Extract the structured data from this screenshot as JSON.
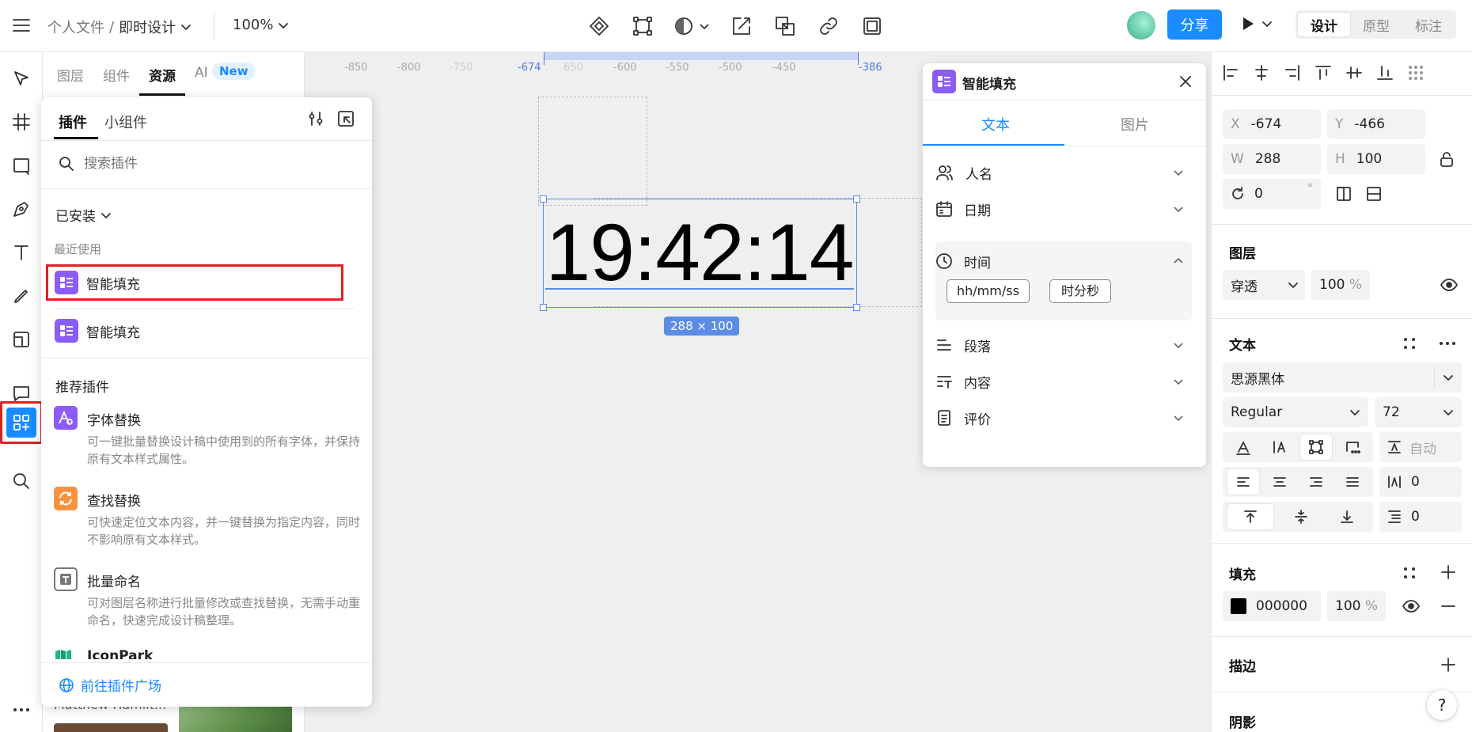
{
  "topbar": {
    "breadcrumb_parent": "个人文件",
    "breadcrumb_sep": "/",
    "file_name": "即时设计",
    "zoom": "100%",
    "share_label": "分享",
    "modes": [
      "设计",
      "原型",
      "标注"
    ]
  },
  "layers_panel": {
    "tabs": [
      "图层",
      "组件",
      "资源",
      "AI"
    ],
    "ai_badge": "New",
    "bottom_caption": "Matthew Hamilt..."
  },
  "plugin_popover": {
    "tabs": [
      "插件",
      "小组件"
    ],
    "search_placeholder": "搜索插件",
    "installed_label": "已安装",
    "recent_label": "最近使用",
    "recent_items": [
      "智能填充",
      "智能填充"
    ],
    "recommend_label": "推荐插件",
    "recommended": [
      {
        "title": "字体替换",
        "desc": "可一键批量替换设计稿中使用到的所有字体，并保持原有文本样式属性。"
      },
      {
        "title": "查找替换",
        "desc": "可快速定位文本内容，并一键替换为指定内容，同时不影响原有文本样式。"
      },
      {
        "title": "批量命名",
        "desc": "可对图层名称进行批量修改或查找替换，无需手动重命名，快速完成设计稿整理。"
      },
      {
        "title": "IconPark",
        "desc": ""
      }
    ],
    "footer_link": "前往插件广场"
  },
  "canvas": {
    "ruler_ticks": [
      "-850",
      "-800",
      "-750",
      "-674",
      "650",
      "-600",
      "-550",
      "-500",
      "-450",
      "-386"
    ],
    "text_content": "19:42:14",
    "size_badge": "288 × 100"
  },
  "smart_fill": {
    "title": "智能填充",
    "tabs": [
      "文本",
      "图片"
    ],
    "rows": [
      "人名",
      "日期",
      "时间",
      "段落",
      "内容",
      "评价"
    ],
    "time_options": [
      "hh/mm/ss",
      "时分秒"
    ]
  },
  "props": {
    "x_label": "X",
    "x": "-674",
    "y_label": "Y",
    "y": "-466",
    "w_label": "W",
    "w": "288",
    "h_label": "H",
    "h": "100",
    "rotation": "0",
    "rotation_unit": "°",
    "layer_section": "图层",
    "blend_mode": "穿透",
    "layer_opacity": "100",
    "pct": "%",
    "text_section": "文本",
    "font_family": "思源黑体",
    "font_weight": "Regular",
    "font_size": "72",
    "auto_label": "自动",
    "letter_spacing": "0",
    "para_spacing": "0",
    "fill_section": "填充",
    "fill_hex": "000000",
    "fill_opacity": "100",
    "stroke_section": "描边",
    "shadow_section": "阴影"
  },
  "colors": {
    "accent": "#1a8cff",
    "highlight": "#e02020",
    "plugin_purple": "#8b5cf6"
  }
}
